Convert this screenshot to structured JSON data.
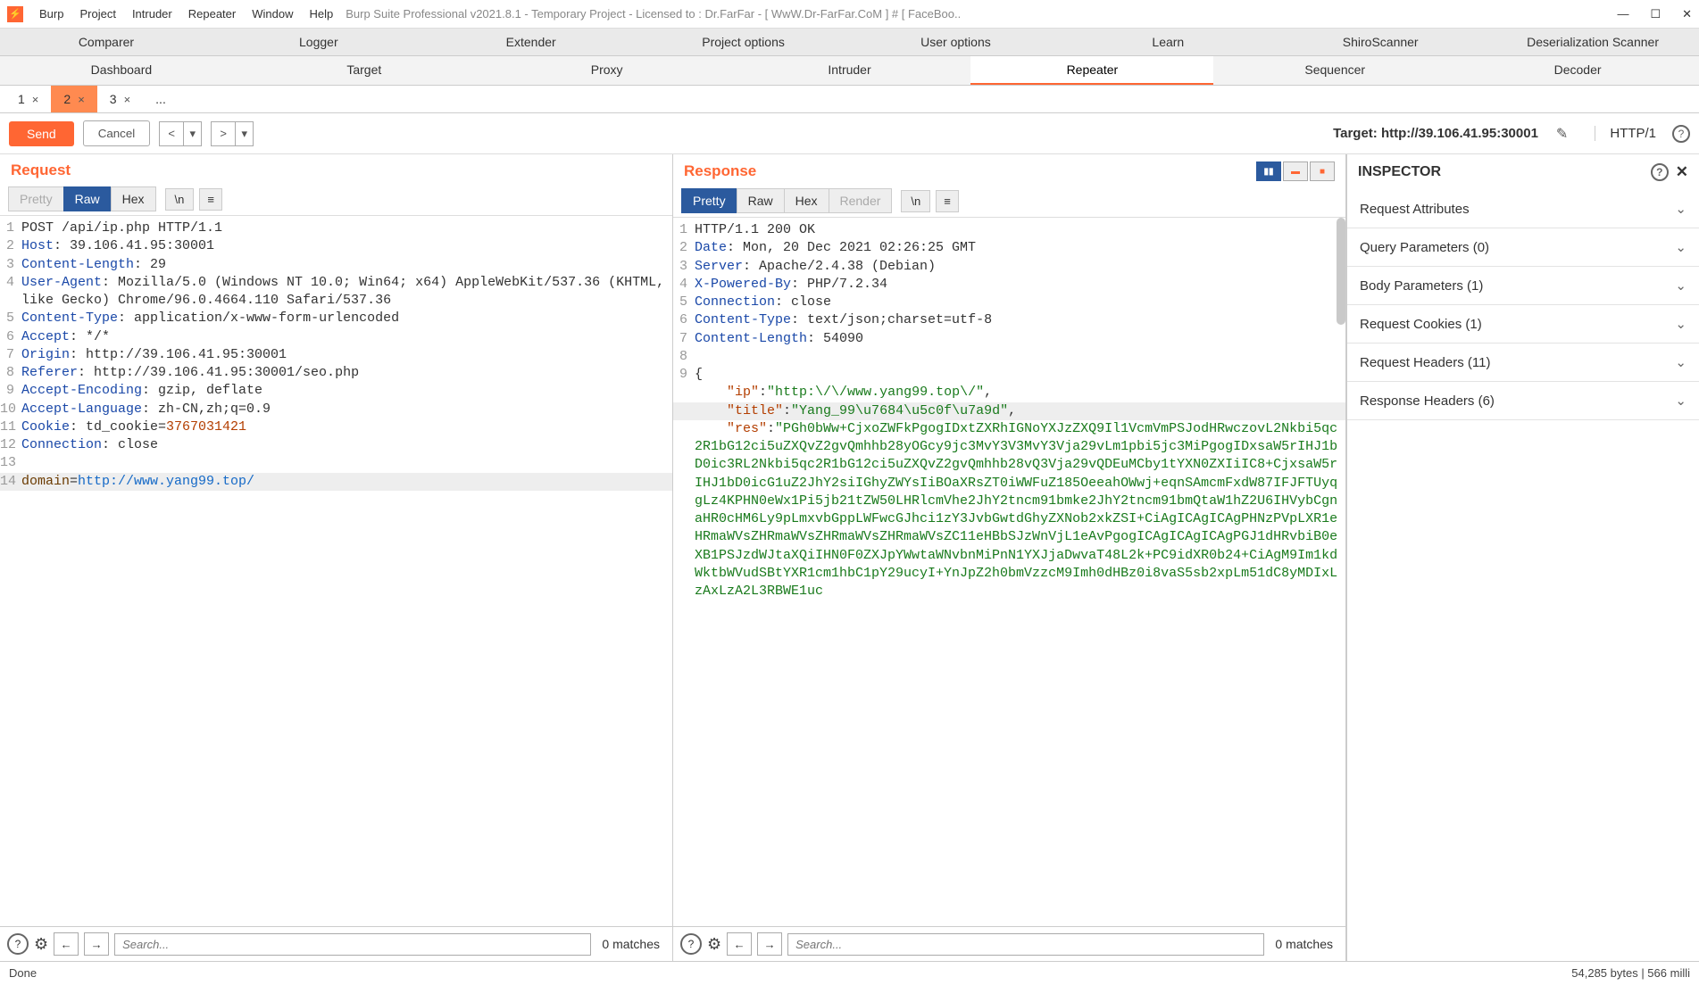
{
  "title": "Burp Suite Professional v2021.8.1 - Temporary Project - Licensed to : Dr.FarFar - [ WwW.Dr-FarFar.CoM ] # [ FaceBoo..",
  "menubar": [
    "Burp",
    "Project",
    "Intruder",
    "Repeater",
    "Window",
    "Help"
  ],
  "ext_tabs": [
    "Comparer",
    "Logger",
    "Extender",
    "Project options",
    "User options",
    "Learn",
    "ShiroScanner",
    "Deserialization Scanner"
  ],
  "primary_tabs": [
    "Dashboard",
    "Target",
    "Proxy",
    "Intruder",
    "Repeater",
    "Sequencer",
    "Decoder"
  ],
  "primary_active": 4,
  "sub_tabs": [
    "1",
    "2",
    "3",
    "..."
  ],
  "sub_active": 1,
  "toolbar": {
    "send": "Send",
    "cancel": "Cancel",
    "target_label": "Target: http://39.106.41.95:30001",
    "httpver": "HTTP/1"
  },
  "request": {
    "title": "Request",
    "tabs": [
      "Pretty",
      "Raw",
      "Hex"
    ],
    "active": 1,
    "nl": "\\n",
    "lines": [
      {
        "n": 1,
        "plain": "POST /api/ip.php HTTP/1.1"
      },
      {
        "n": 2,
        "k": "Host",
        "v": " 39.106.41.95:30001"
      },
      {
        "n": 3,
        "k": "Content-Length",
        "v": " 29"
      },
      {
        "n": 4,
        "k": "User-Agent",
        "v": " Mozilla/5.0 (Windows NT 10.0; Win64; x64) AppleWebKit/537.36 (KHTML, like Gecko) Chrome/96.0.4664.110 Safari/537.36"
      },
      {
        "n": 5,
        "k": "Content-Type",
        "v": " application/x-www-form-urlencoded"
      },
      {
        "n": 6,
        "k": "Accept",
        "v": " */*"
      },
      {
        "n": 7,
        "k": "Origin",
        "v": " http://39.106.41.95:30001"
      },
      {
        "n": 8,
        "k": "Referer",
        "v": " http://39.106.41.95:30001/seo.php"
      },
      {
        "n": 9,
        "k": "Accept-Encoding",
        "v": " gzip, deflate"
      },
      {
        "n": 10,
        "k": "Accept-Language",
        "v": " zh-CN,zh;q=0.9"
      },
      {
        "n": 11,
        "k": "Cookie",
        "v": " td_cookie=",
        "num": "3767031421"
      },
      {
        "n": 12,
        "k": "Connection",
        "v": " close"
      },
      {
        "n": 13,
        "plain": ""
      },
      {
        "n": 14,
        "form_k": "domain",
        "form_eq": "=",
        "url": "http://www.yang99.top/",
        "sel": true
      }
    ]
  },
  "response": {
    "title": "Response",
    "tabs": [
      "Pretty",
      "Raw",
      "Hex",
      "Render"
    ],
    "active": 0,
    "nl": "\\n",
    "lines": [
      {
        "n": 1,
        "plain": "HTTP/1.1 200 OK"
      },
      {
        "n": 2,
        "k": "Date",
        "v": " Mon, 20 Dec 2021 02:26:25 GMT"
      },
      {
        "n": 3,
        "k": "Server",
        "v": " Apache/2.4.38 (Debian)"
      },
      {
        "n": 4,
        "k": "X-Powered-By",
        "v": " PHP/7.2.34"
      },
      {
        "n": 5,
        "k": "Connection",
        "v": " close"
      },
      {
        "n": 6,
        "k": "Content-Type",
        "v": " text/json;charset=utf-8"
      },
      {
        "n": 7,
        "k": "Content-Length",
        "v": " 54090"
      },
      {
        "n": 8,
        "plain": ""
      },
      {
        "n": 9,
        "plain": "{"
      },
      {
        "n": "",
        "indent": "    ",
        "jk": "\"ip\"",
        "sep": ":",
        "jv": "\"http:\\/\\/www.yang99.top\\/\"",
        "tail": ","
      },
      {
        "n": "",
        "indent": "    ",
        "jk": "\"title\"",
        "sep": ":",
        "jv": "\"Yang_99\\u7684\\u5c0f\\u7a9d\"",
        "tail": ",",
        "sel": true
      },
      {
        "n": "",
        "indent": "    ",
        "jk": "\"res\"",
        "sep": ":",
        "jv": "\"PGh0bWw+CjxoZWFkPgogIDxtZXRhIGNoYXJzZXQ9Il1VcmVmPSJodHRwczovL2Nkbi5qc2R1bG12ci5uZXQvZ2gvQmhhb28yOGcy9jc3MvY3V3MvY3Vja29vLm1pbi5jc3MiPgogIDxsaW5rIHJ1bD0ic3RL2Nkbi5qc2R1bG12ci5uZXQvZ2gvQmhhb28vQ3Vja29vQDEuMCby1tYXN0ZXIiIC8+CjxsaW5rIHJ1bD0icG1uZ2JhY2siIGhyZWYsIiBOaXRsZT0iWWFuZ185OeeahOWwj+eqnSAmcmFxdW87IFJFTUyqgLz4KPHN0eWx1Pi5jb21tZW50LHRlcmVhe2JhY2tncm91bmke2JhY2tncm91bmQtaW1hZ2U6IHVybCgnaHR0cHM6Ly9pLmxvbGppLWFwcGJhci1zY3JvbGwtdGhyZXNob2xkZSI+CiAgICAgICAgPHNzPVpLXR1eHRmaWVsZHRmaWVsZHRmaWVsZHRmaWVsZC11eHBbSJzWnVjL1eAvPgogICAgICAgICAgPGJ1dHRvbiB0eXB1PSJzdWJtaXQiIHN0F0ZXJpYWwtaWNvbnMiPnN1YXJjaDwvaT48L2k+PC9idXR0b24+CiAgM9Im1kdWktbWVudSBtYXR1cm1hbC1pY29ucyI+YnJpZ2h0bmVzzcM9Imh0dHBz0i8vaS5sb2xpLm51dC8yMDIxLzAxLzA2L3RBWE1uc"
      }
    ]
  },
  "search": {
    "placeholder": "Search...",
    "matches": "0 matches"
  },
  "inspector": {
    "title": "INSPECTOR",
    "items": [
      "Request Attributes",
      "Query Parameters (0)",
      "Body Parameters (1)",
      "Request Cookies (1)",
      "Request Headers (11)",
      "Response Headers (6)"
    ]
  },
  "status": {
    "left": "Done",
    "right": "54,285 bytes | 566 milli"
  }
}
